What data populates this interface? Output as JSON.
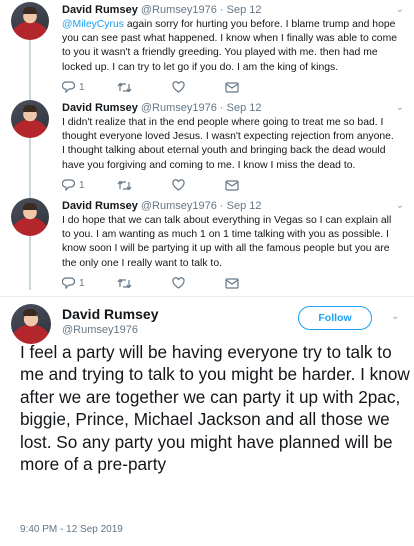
{
  "tweets": [
    {
      "name": "David Rumsey",
      "handle": "@Rumsey1976",
      "dot": "·",
      "date": "Sep 12",
      "mention": "@MileyCyrus",
      "text": " again sorry for hurting you before. I blame trump and hope you can see past what happened. I know when I finally was able to come to you it wasn't a friendly greeding. You played with me. then had me locked up. I can try to let go if you do. I am the king of kings.",
      "replies": "1",
      "retweets": "",
      "likes": ""
    },
    {
      "name": "David Rumsey",
      "handle": "@Rumsey1976",
      "dot": "·",
      "date": "Sep 12",
      "text": "I didn't realize that in the end people where going to treat me so bad. I thought everyone loved Jesus. I wasn't expecting rejection from anyone. I thought talking about eternal youth and bringing back the dead would have you forgiving and coming to me. I know I miss the dead to.",
      "replies": "1",
      "retweets": "",
      "likes": ""
    },
    {
      "name": "David Rumsey",
      "handle": "@Rumsey1976",
      "dot": "·",
      "date": "Sep 12",
      "text": "I do hope that we can talk about everything in Vegas so I can explain all to you. I am wanting as much 1 on 1 time talking with you as possible. I know soon I will be partying it up with all the famous people but you are the only one I really want to talk to.",
      "replies": "1",
      "retweets": "",
      "likes": ""
    }
  ],
  "main": {
    "name": "David Rumsey",
    "handle": "@Rumsey1976",
    "follow_label": "Follow",
    "text": "I feel a party will be having everyone try to talk to me and trying to talk to you might be harder. I know after we are together we can party it up with 2pac, biggie, Prince, Michael Jackson and all those we lost. So any party you might have planned will be more of a pre-party",
    "timestamp": "9:40 PM - 12 Sep 2019"
  },
  "colors": {
    "link": "#1da1f2",
    "text": "#14171a",
    "muted": "#657786",
    "thread_line": "#ccd6dd"
  }
}
